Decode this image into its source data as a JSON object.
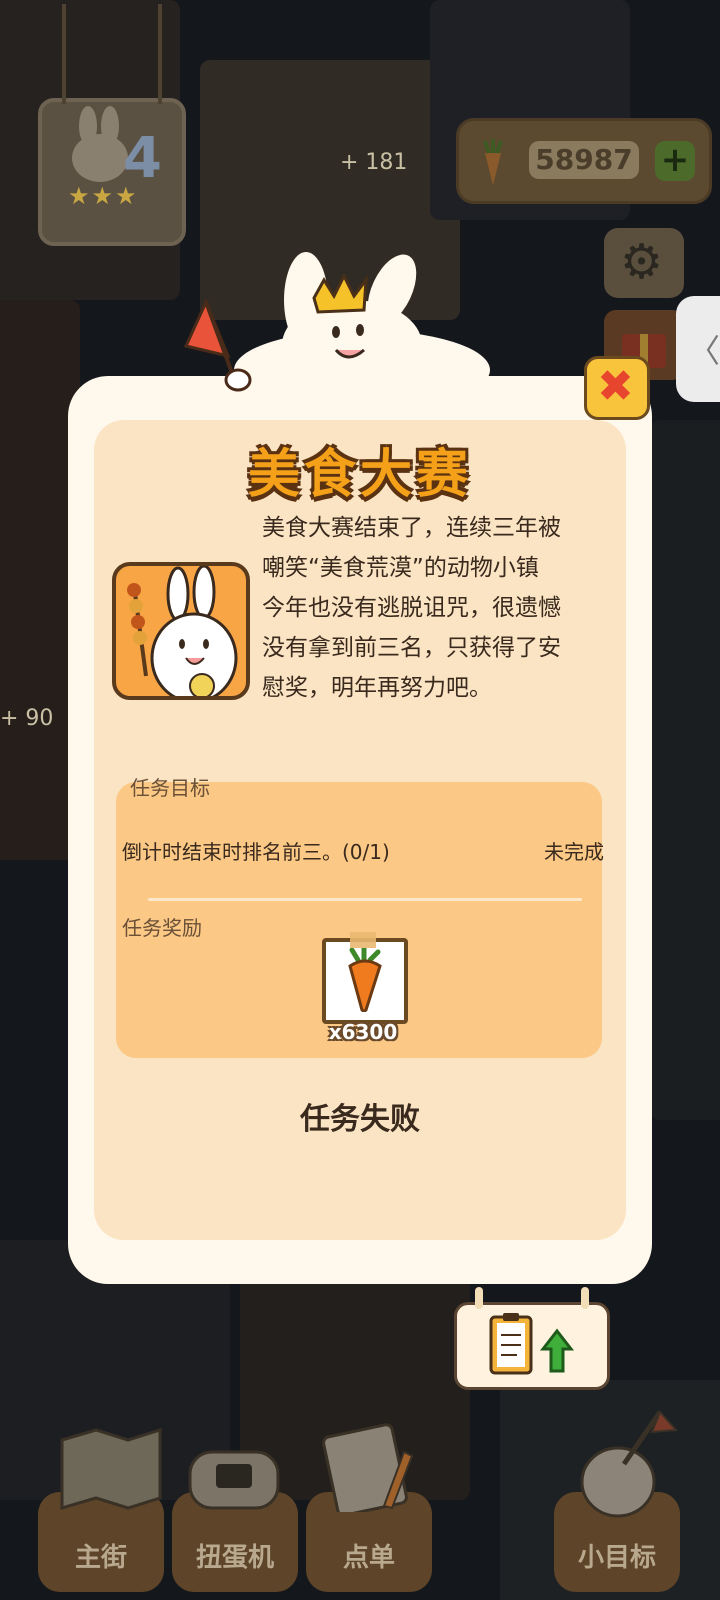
{
  "hud": {
    "level": "4",
    "carrot_count": "58987",
    "bonus_top": "+ 181",
    "bonus_left": "+ 90"
  },
  "dialog": {
    "title": "美食大赛",
    "story_lines": [
      "美食大赛结束了，连续三年被",
      "嘲笑“美食荒漠”的动物小镇",
      "今年也没有逃脱诅咒，很遗憾",
      "没有拿到前三名，只获得了安",
      "慰奖，明年再努力吧。"
    ],
    "task_goal_label": "任务目标",
    "task_text": "倒计时结束时排名前三。(0/1)",
    "task_status": "未完成",
    "reward_label": "任务奖励",
    "reward_qty": "x6300",
    "result": "任务失败"
  },
  "nav": {
    "items": [
      {
        "label": "主街"
      },
      {
        "label": "扭蛋机"
      },
      {
        "label": "点单"
      },
      {
        "label": ""
      },
      {
        "label": "小目标"
      }
    ]
  },
  "colors": {
    "title_fill": "#f5a019",
    "title_outline": "#5a3212",
    "dialog_bg": "#fff8ec",
    "panel_bg": "#fbc886",
    "close_red": "#e8452e"
  },
  "icons": [
    "carrot-icon",
    "gear-icon",
    "gift-icon",
    "close-icon",
    "flag-icon",
    "clipboard-icon",
    "map-icon",
    "gamepad-icon",
    "order-icon",
    "bunny-hand-icon"
  ]
}
